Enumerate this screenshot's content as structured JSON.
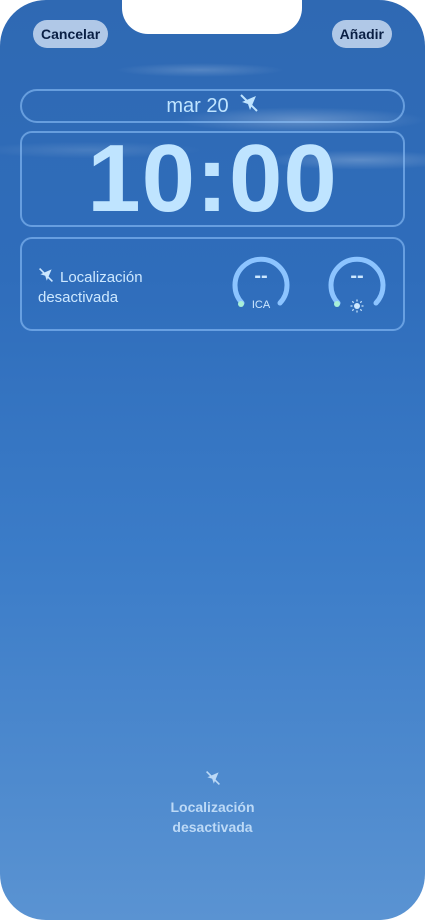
{
  "header": {
    "cancel_label": "Cancelar",
    "add_label": "Añadir"
  },
  "lock_screen": {
    "date": "mar 20",
    "time": "10:00"
  },
  "widgets": {
    "location_line1": "Localización",
    "location_line2": "desactivada",
    "aqi_value": "--",
    "aqi_label": "ICA",
    "uv_value": "--"
  },
  "footer": {
    "location_line1": "Localización",
    "location_line2": "desactivada"
  },
  "colors": {
    "accent": "#bfe4ff",
    "gauge_track": "#8cc4ff",
    "gauge_dot": "#a8f0d8",
    "button_bg": "#dce8f8",
    "button_text": "#0a1f44"
  },
  "icons": {
    "date_icon": "location-off-icon",
    "widget_icon": "location-off-icon",
    "uv_icon": "sun-icon",
    "footer_icon": "location-off-icon"
  }
}
